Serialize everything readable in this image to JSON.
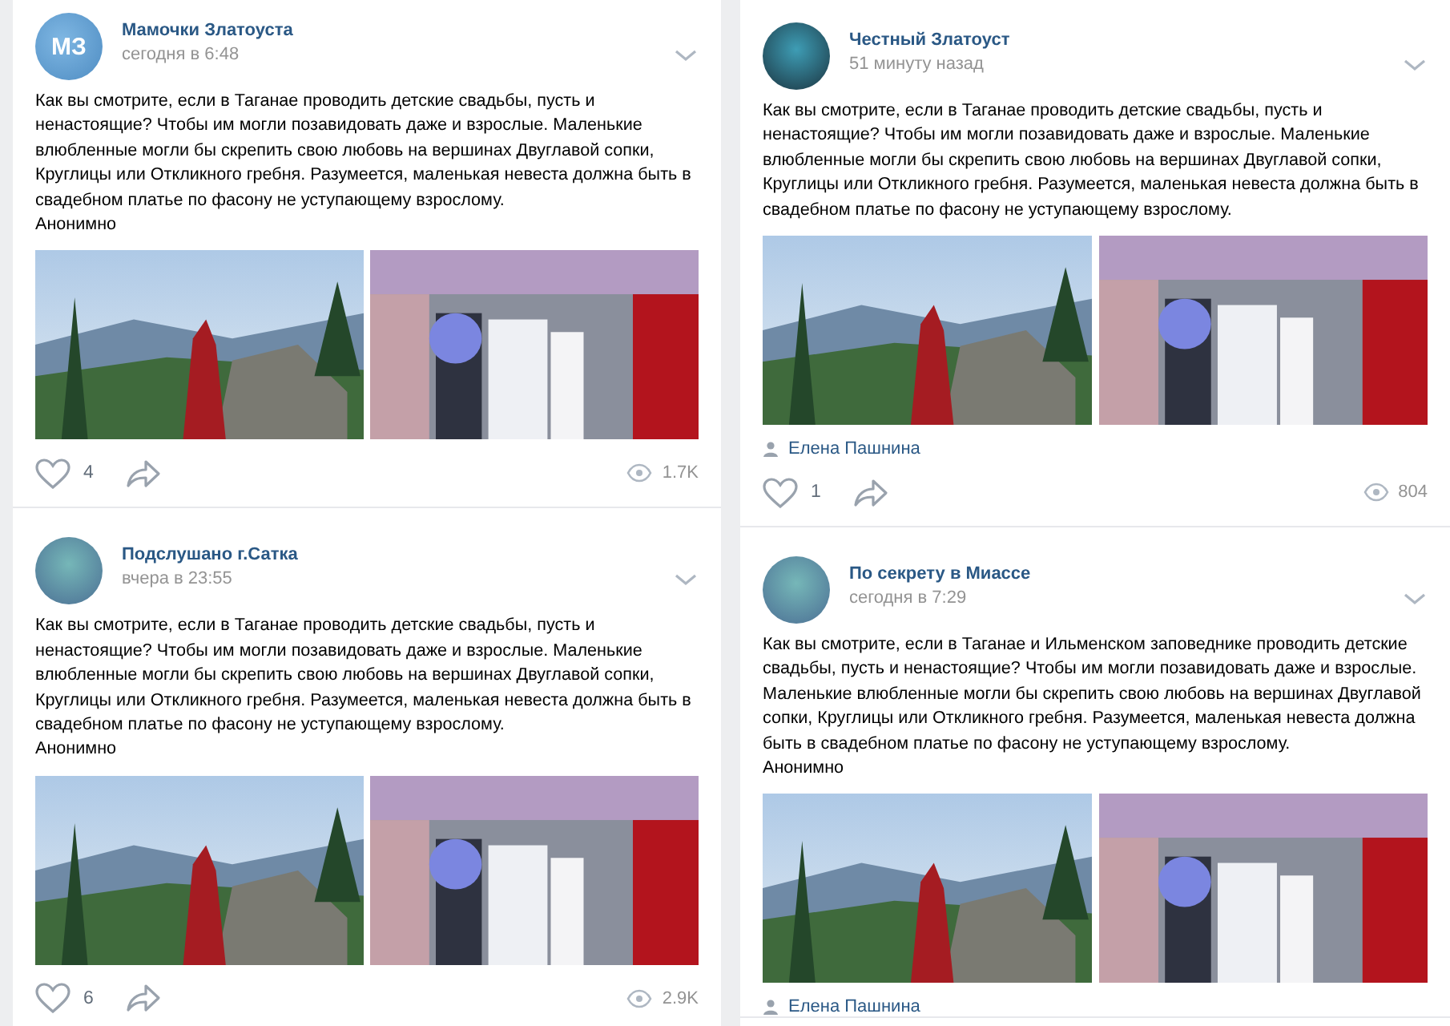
{
  "columns": [
    {
      "posts": [
        {
          "name": "Мамочки Златоуста",
          "time": "сегодня в 6:48",
          "avatar_text": "МЗ",
          "text": "Как вы смотрите, если в Таганае проводить детские свадьбы, пусть и ненастоящие? Чтобы им могли позавидовать даже и взрослые. Маленькие влюбленные могли бы скрепить свою любовь на вершинах Двуглавой сопки, Круглицы или Откликного гребня. Разумеется, маленькая невеста должна быть в свадебном платье по фасону не уступающему взрослому.",
          "signature": "Анонимно",
          "photos": [
            {
              "kind": "landscape"
            },
            {
              "kind": "ceremony"
            }
          ],
          "likes": "4",
          "views": "1.7K"
        },
        {
          "name": "Подслушано г.Сатка",
          "time": "вчера в 23:55",
          "text": "Как вы смотрите, если в Таганае проводить детские свадьбы, пусть и ненастоящие? Чтобы им могли позавидовать даже и взрослые. Маленькие влюбленные могли бы скрепить свою любовь на вершинах Двуглавой сопки, Круглицы или Откликного гребня. Разумеется, маленькая невеста должна быть в свадебном платье по фасону не уступающему взрослому.",
          "signature": "Анонимно",
          "photos": [
            {
              "kind": "landscape"
            },
            {
              "kind": "ceremony"
            }
          ],
          "likes": "6",
          "views": "2.9K"
        }
      ]
    },
    {
      "posts": [
        {
          "name": "Честный Златоуст",
          "time": "51 минуту назад",
          "text": "Как вы смотрите, если в Таганае проводить детские свадьбы, пусть и ненастоящие? Чтобы им могли позавидовать даже и взрослые. Маленькие влюбленные могли бы скрепить свою любовь на вершинах Двуглавой сопки, Круглицы или Откликного гребня. Разумеется, маленькая невеста должна быть в свадебном платье по фасону не уступающему взрослому.",
          "photos": [
            {
              "kind": "landscape"
            },
            {
              "kind": "ceremony"
            }
          ],
          "author": "Елена Пашнина",
          "likes": "1",
          "views": "804"
        },
        {
          "name": "По секрету в Миассе",
          "time": "сегодня в 7:29",
          "text": "Как вы смотрите, если в Таганае и Ильменском заповеднике проводить детские свадьбы, пусть и ненастоящие? Чтобы им могли позавидовать даже и взрослые. Маленькие влюбленные могли бы скрепить свою любовь на вершинах Двуглавой сопки, Круглицы или Откликного гребня. Разумеется, маленькая невеста должна быть в свадебном платье по фасону не уступающему взрослому.",
          "signature": "Анонимно",
          "photos": [
            {
              "kind": "landscape"
            },
            {
              "kind": "ceremony"
            }
          ],
          "author": "Елена Пашнина"
        }
      ]
    }
  ]
}
